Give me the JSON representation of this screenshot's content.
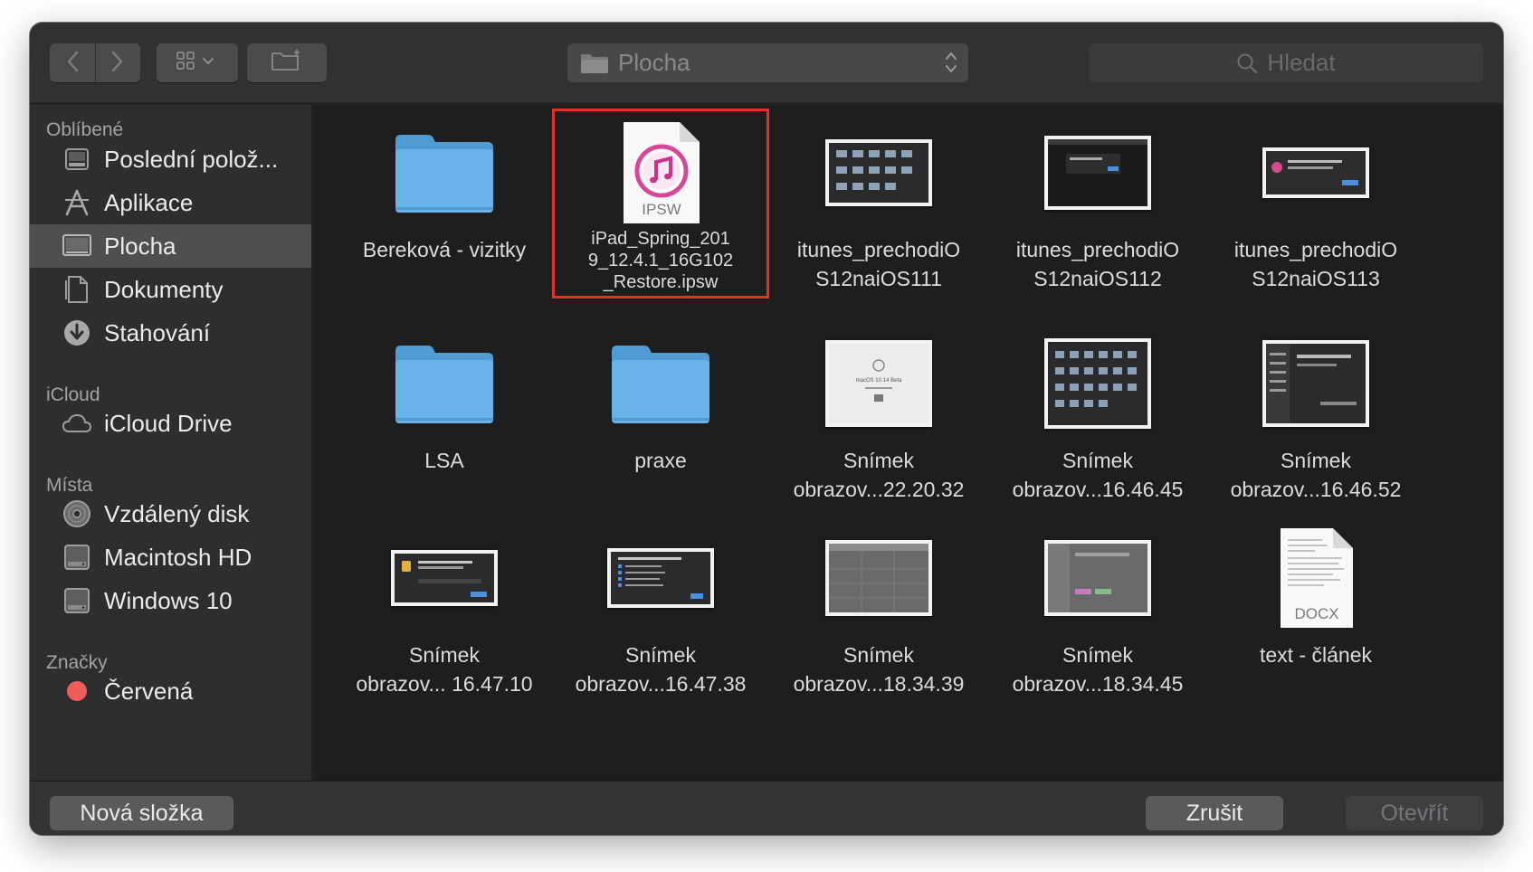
{
  "toolbar": {
    "location": "Plocha",
    "search_placeholder": "Hledat"
  },
  "sidebar": {
    "sections": {
      "favorites": "Oblíbené",
      "icloud": "iCloud",
      "places": "Místa",
      "tags": "Značky"
    },
    "items": [
      {
        "label": "Poslední polož...",
        "icon": "recents-icon"
      },
      {
        "label": "Aplikace",
        "icon": "applications-icon"
      },
      {
        "label": "Plocha",
        "icon": "desktop-icon",
        "selected": true
      },
      {
        "label": "Dokumenty",
        "icon": "documents-icon"
      },
      {
        "label": "Stahování",
        "icon": "downloads-icon"
      },
      {
        "label": "iCloud Drive",
        "icon": "cloud-icon"
      },
      {
        "label": "Vzdálený disk",
        "icon": "remote-disc-icon"
      },
      {
        "label": "Macintosh HD",
        "icon": "hard-drive-icon"
      },
      {
        "label": "Windows 10",
        "icon": "hard-drive-icon"
      },
      {
        "label": "Červená",
        "icon": "red-tag-icon",
        "color": "#ee5d57"
      }
    ]
  },
  "files": [
    {
      "label": "Bereková - vizitky",
      "kind": "folder"
    },
    {
      "label": "iPad_Spring_2019_12.4.1_16G102_Restore.ipsw",
      "label_lines": [
        "iPad_Spring_201",
        "9_12.4.1_16G102",
        "_Restore.ipsw"
      ],
      "kind": "ipsw",
      "badge": "IPSW",
      "highlighted": true
    },
    {
      "label": "itunes_prechodiOS12naiOS111",
      "label_lines": [
        "itunes_prechodiO",
        "S12naiOS111"
      ],
      "kind": "screenshot"
    },
    {
      "label": "itunes_prechodiOS12naiOS112",
      "label_lines": [
        "itunes_prechodiO",
        "S12naiOS112"
      ],
      "kind": "screenshot"
    },
    {
      "label": "itunes_prechodiOS12naiOS113",
      "label_lines": [
        "itunes_prechodiO",
        "S12naiOS113"
      ],
      "kind": "screenshot"
    },
    {
      "label": "LSA",
      "kind": "folder"
    },
    {
      "label": "praxe",
      "kind": "folder"
    },
    {
      "label_lines": [
        "Snímek",
        "obrazov...22.20.32"
      ],
      "kind": "screenshot"
    },
    {
      "label_lines": [
        "Snímek",
        "obrazov...16.46.45"
      ],
      "kind": "screenshot"
    },
    {
      "label_lines": [
        "Snímek",
        "obrazov...16.46.52"
      ],
      "kind": "screenshot"
    },
    {
      "label_lines": [
        "Snímek",
        "obrazov... 16.47.10"
      ],
      "kind": "screenshot"
    },
    {
      "label_lines": [
        "Snímek",
        "obrazov...16.47.38"
      ],
      "kind": "screenshot"
    },
    {
      "label_lines": [
        "Snímek",
        "obrazov...18.34.39"
      ],
      "kind": "screenshot"
    },
    {
      "label_lines": [
        "Snímek",
        "obrazov...18.34.45"
      ],
      "kind": "screenshot"
    },
    {
      "label": "text - článek",
      "kind": "docx",
      "badge": "DOCX"
    }
  ],
  "thumb_text": {
    "macos_beta": "macOS 10.14 Beta"
  },
  "footer": {
    "new_folder": "Nová složka",
    "cancel": "Zrušit",
    "open": "Otevřít"
  },
  "colors": {
    "highlight": "#e0322d",
    "folder": "#6ab3e8",
    "selected_row": "#4f4f52"
  }
}
